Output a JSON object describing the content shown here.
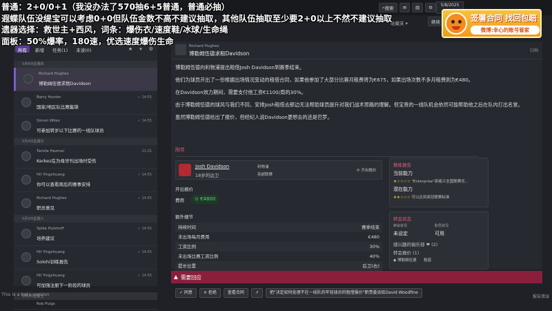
{
  "overlay_text": [
    "普通：2+0/0+1（我没办法了570抽6+5普通，普通必抽）",
    "遐蝶队伍没缇宝可以考虑0+0但队伍金数不高不建议抽取，其他队伍抽取至少要2+0以上不然不建议抽取",
    "遗器选择：救世主+西风，词条：爆伤衣/速度鞋/冰球/生命绳",
    "面板：50%爆率，180速，优选速度爆伤生命"
  ],
  "ad": {
    "title": "签署合同 找回包赔",
    "subtitle": "微博:幸心的账号管家"
  },
  "topbar": {
    "search": "搜索",
    "date": "5/8/2025",
    "next": "继续",
    "favorites": "收藏夹"
  },
  "left_panel": {
    "tabs": [
      "所有",
      "新增",
      "任务(1)",
      "未读(0)"
    ],
    "tools": [
      "★",
      "▾",
      "⚙"
    ],
    "items": [
      {
        "group": "5月8日星期四",
        "name": "Richard Hughes",
        "subject": "博勒姆伍德求租Davidson",
        "time": "",
        "selected": true
      },
      {
        "group": "",
        "name": "Barry Hunter",
        "subject": "国家/地区队比赛集锦",
        "time": "✓ 14:55"
      },
      {
        "group": "",
        "name": "Simon Wiles",
        "subject": "可参加转岁以下比赛的一线队球员",
        "time": "✓ 14:55"
      },
      {
        "group": "5月4日星期日",
        "name": "Tamila Hezmal",
        "subject": "Kerkez在为母牙刊出场时受伤",
        "time": "21:01"
      },
      {
        "group": "",
        "name": "Hil Yingshuang",
        "subject": "你可以查看周后的赛事安排",
        "time": "✓ 14:55"
      },
      {
        "group": "",
        "name": "Richard Hughes",
        "subject": "职员意见",
        "time": "✓ 14:55"
      },
      {
        "group": "5月3日星期六",
        "name": "Spike Hulshoff",
        "subject": "培养建议",
        "time": "✓ 14:55"
      },
      {
        "group": "",
        "name": "Hil Yingshuang",
        "subject": "Solohi训练报告",
        "time": "✓ 14:55"
      },
      {
        "group": "",
        "name": "Hil Yingshuang",
        "subject": "可加强注册下一阶段的球员",
        "time": "✓ 14:55"
      },
      {
        "group": "5月2日星期五",
        "name": "Rob Puigs",
        "subject": "",
        "time": ""
      }
    ]
  },
  "message": {
    "sender": "Richard Hughes",
    "subject": "博勒姆伍德求租Davidson",
    "archive": "归档",
    "paragraphs": [
      "博勒姆伍德向利物浦提出租借Josh Davidson到赛季结束。",
      "他们为球员开出了一份根据出场情况变动的租借合同，如果他参加了大部分比赛月租费将为€675，如果出场次数不多月租费则为€480。",
      "在Davidson效力期间，需要支付他工资€1100/周的30%。",
      "由于博勒姆伍德的球风与我们不同，安排Josh租借去那边无法帮助球员提升对我们战术思路的理解。但宝贵的一线队机会依然可能帮助他之后在队内打出名堂。",
      "虽然博勒姆伍德给出了报价，但经纪人说Davidson更想去的还是巴罗。"
    ],
    "attachment_label": "附件",
    "player": {
      "name": "Josh Davidson",
      "age": "18岁的边卫",
      "club": "利物浦",
      "to_club": "英超联赛",
      "status": "开出报价"
    },
    "offer_label": "开出报价",
    "fee_label": "费用",
    "fee": "€4800",
    "extra_label": "额外细节",
    "table": [
      {
        "k": "持续时间",
        "v": "赛季结束"
      },
      {
        "k": "未出场每月费用",
        "v": "€480"
      },
      {
        "k": "工资比例",
        "v": "30%"
      },
      {
        "k": "未出场比赛工资比例",
        "v": "40%"
      },
      {
        "k": "提长位置",
        "v": "后卫(右)"
      }
    ],
    "scout": {
      "title": "教练报告",
      "cur_label": "当前能力",
      "cur_note": "\"Enterprise\"英格兰全国联赛优...",
      "pot_label": "潜在能力",
      "pot_note": "可以达到英冠联赛标准"
    },
    "transfer": {
      "title": "转会状态",
      "col1_h": "转会状况",
      "col2_h": "职员状况",
      "col1_v": "未设定",
      "col2_v": "可用",
      "clubs_label": "感兴趣的俱乐部 ❤ (2)",
      "offers_label": "转会报价 (1)",
      "offer_club": "博勒姆伍德",
      "offer_type": "租借"
    }
  },
  "action_bar": {
    "title": "需要回应",
    "buttons": [
      "✓ 同意",
      "✕ 拒绝",
      "查看合同",
      "↗",
      "把\"决定如何处理不在一线队的年轻球员的租借报价\"职责委派给David Woodfine"
    ]
  },
  "footer": {
    "beta": "This is a beta version",
    "right": "报告错误"
  }
}
